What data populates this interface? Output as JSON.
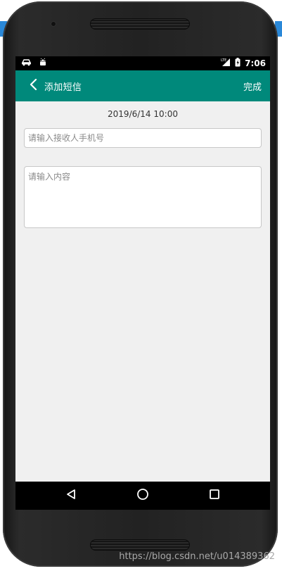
{
  "status_bar": {
    "left_icons": [
      "car-icon",
      "android-icon"
    ],
    "right_icons": [
      "lte-signal-icon",
      "battery-icon"
    ],
    "time": "7:06"
  },
  "app_bar": {
    "back_icon": "chevron-left-icon",
    "title": "添加短信",
    "done_label": "完成",
    "color": "#00897b"
  },
  "form": {
    "datetime": "2019/6/14 10:00",
    "recipient": {
      "placeholder": "请输入接收人手机号",
      "value": ""
    },
    "content": {
      "placeholder": "请输入内容",
      "value": ""
    }
  },
  "nav_bar": {
    "buttons": [
      "back-triangle-icon",
      "home-circle-icon",
      "recents-square-icon"
    ]
  },
  "watermark": "https://blog.csdn.net/u014389362"
}
